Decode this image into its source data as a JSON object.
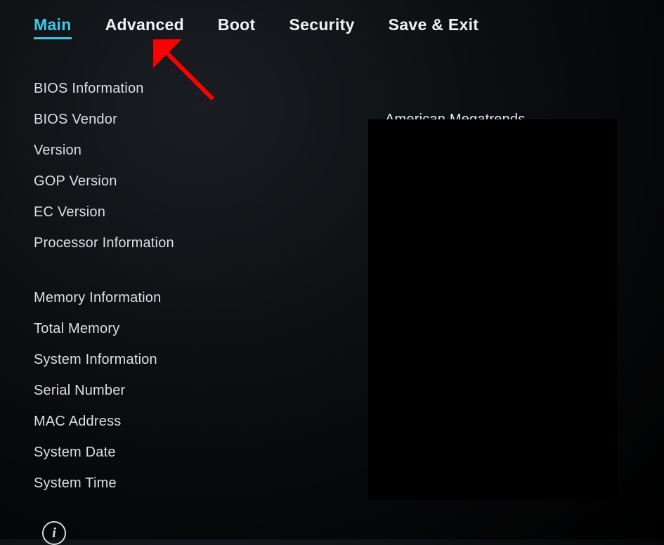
{
  "tabs": {
    "main": "Main",
    "advanced": "Advanced",
    "boot": "Boot",
    "security": "Security",
    "saveexit": "Save & Exit"
  },
  "sections": {
    "bios_info_header": "BIOS Information",
    "bios_vendor_label": "BIOS Vendor",
    "bios_vendor_value": "American Megatrends",
    "version_label": "Version",
    "gop_version_label": "GOP Version",
    "ec_version_label": "EC Version",
    "processor_info_header": "Processor Information",
    "memory_info_header": "Memory Information",
    "total_memory_label": "Total Memory",
    "system_info_header": "System Information",
    "serial_number_label": "Serial Number",
    "mac_address_label": "MAC Address",
    "system_date_label": "System Date",
    "system_time_label": "System Time"
  },
  "annotation": {
    "arrow_color": "#ff0000",
    "target": "advanced-tab"
  }
}
